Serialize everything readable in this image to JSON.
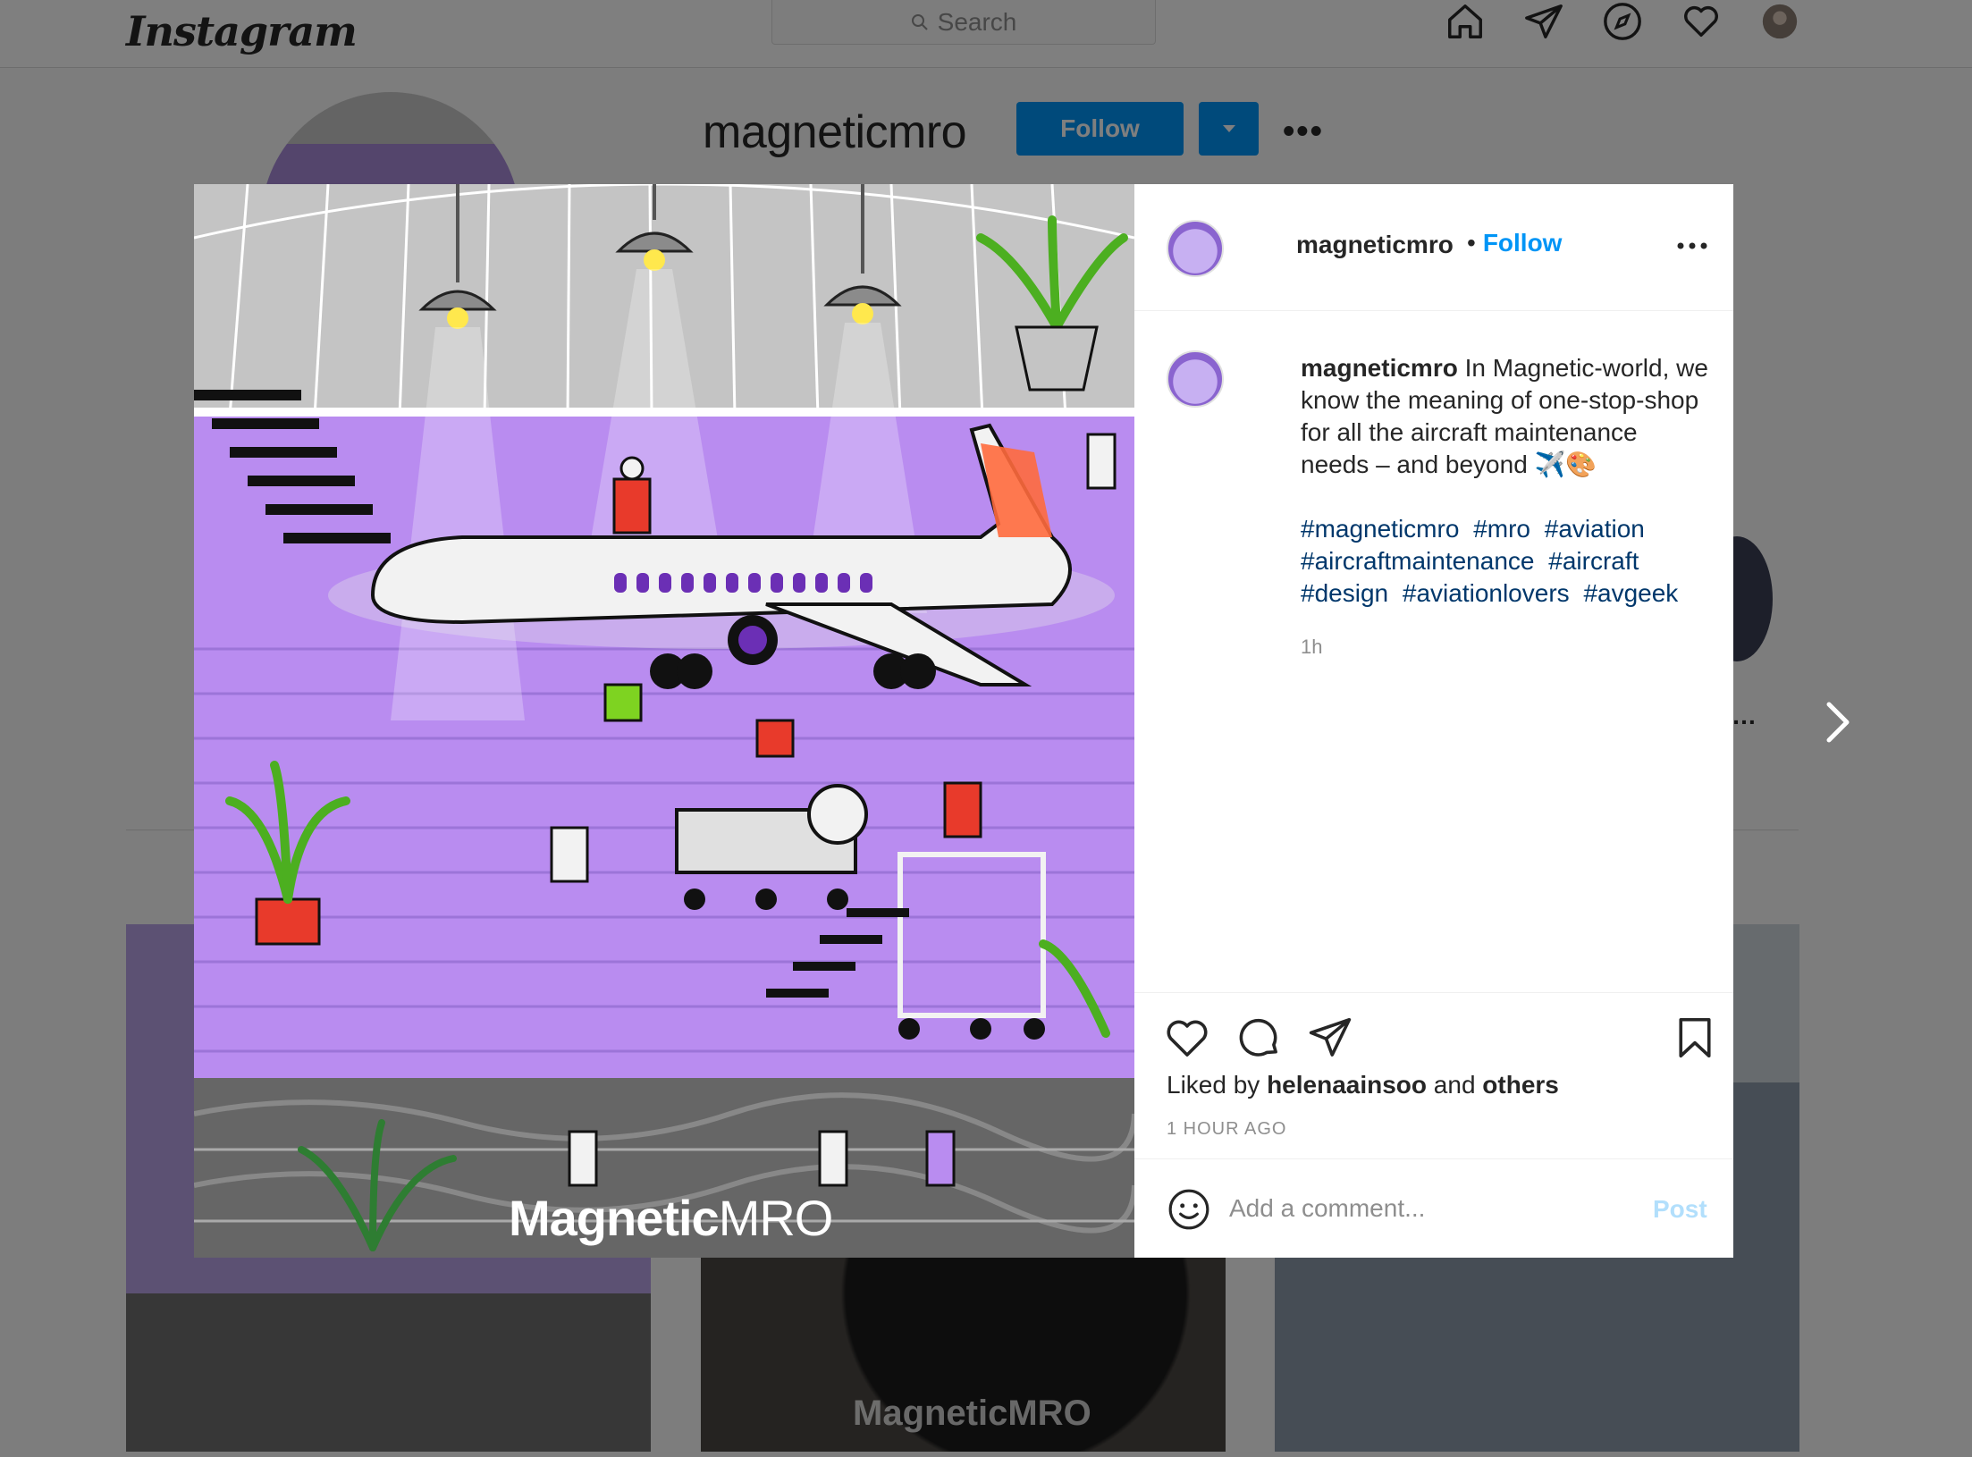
{
  "topbar": {
    "logo": "Instagram",
    "search_placeholder": "Search"
  },
  "icons": {
    "home": "home-icon",
    "direct": "paper-plane-icon",
    "explore": "compass-icon",
    "activity": "heart-icon",
    "profile": "avatar"
  },
  "profile": {
    "username": "magneticmro",
    "follow_label": "Follow"
  },
  "background_tiles": {
    "brand_watermark": "MagneticMRO"
  },
  "post": {
    "brand_logo_bold": "Magnetic",
    "brand_logo_light": "MRO",
    "header": {
      "username": "magneticmro",
      "separator": "•",
      "follow_label": "Follow"
    },
    "caption": {
      "username": "magneticmro",
      "text": "In Magnetic-world, we know the meaning of one-stop-shop for all the aircraft maintenance needs – and beyond ✈️🎨",
      "hashtags": [
        "#magneticmro",
        "#mro",
        "#aviation",
        "#aircraftmaintenance",
        "#aircraft",
        "#design",
        "#aviationlovers",
        "#avgeek"
      ],
      "time": "1h"
    },
    "likes": {
      "prefix": "Liked by",
      "user": "helenaainsoo",
      "middle": "and",
      "others": "others"
    },
    "timestamp": "1 HOUR AGO",
    "comment": {
      "placeholder": "Add a comment...",
      "post_label": "Post"
    }
  },
  "colors": {
    "accent": "#0095f6",
    "hashtag": "#00376b",
    "post_image_purple": "#b98cf0"
  }
}
